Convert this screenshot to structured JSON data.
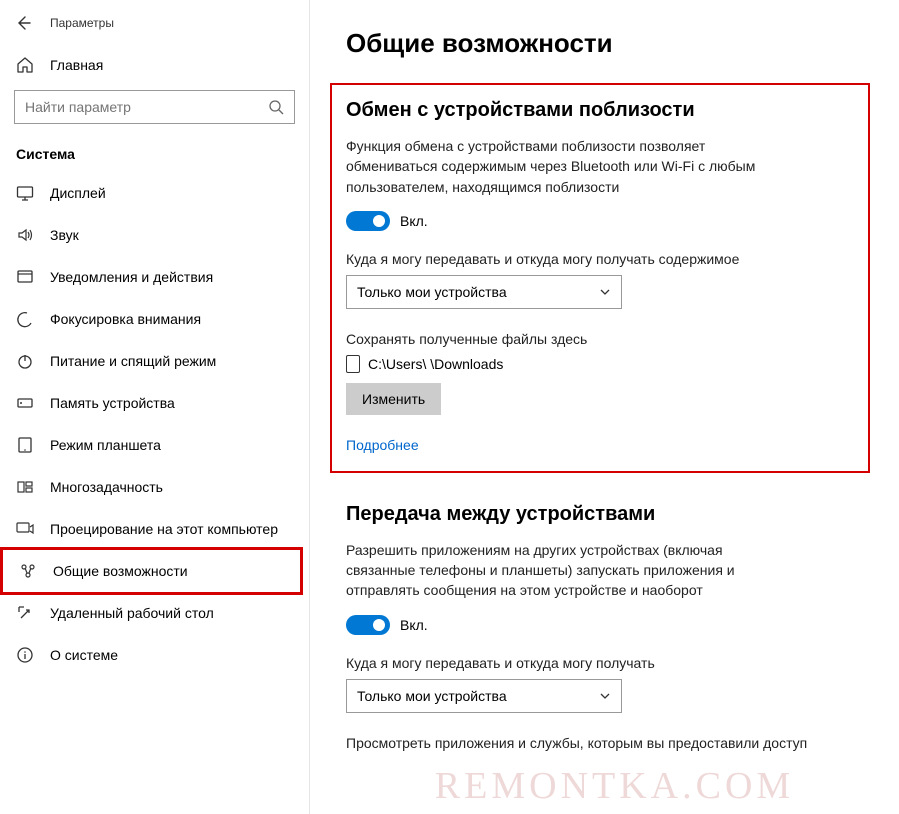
{
  "app_title": "Параметры",
  "home_label": "Главная",
  "search_placeholder": "Найти параметр",
  "category": "Система",
  "nav": [
    {
      "label": "Дисплей"
    },
    {
      "label": "Звук"
    },
    {
      "label": "Уведомления и действия"
    },
    {
      "label": "Фокусировка внимания"
    },
    {
      "label": "Питание и спящий режим"
    },
    {
      "label": "Память устройства"
    },
    {
      "label": "Режим планшета"
    },
    {
      "label": "Многозадачность"
    },
    {
      "label": "Проецирование на этот компьютер"
    },
    {
      "label": "Общие возможности"
    },
    {
      "label": "Удаленный рабочий стол"
    },
    {
      "label": "О системе"
    }
  ],
  "page_title": "Общие возможности",
  "section1": {
    "title": "Обмен с устройствами поблизости",
    "desc": "Функция обмена с устройствами поблизости позволяет обмениваться содержимым через Bluetooth или Wi-Fi с любым пользователем, находящимся поблизости",
    "toggle_label": "Вкл.",
    "share_label": "Куда я могу передавать и откуда могу получать содержимое",
    "dropdown_value": "Только мои устройства",
    "save_label": "Сохранять полученные файлы здесь",
    "save_path": "C:\\Users\\        \\Downloads",
    "change_btn": "Изменить",
    "more_link": "Подробнее"
  },
  "section2": {
    "title": "Передача между устройствами",
    "desc": "Разрешить приложениям на других устройствах (включая связанные телефоны и планшеты) запускать приложения и отправлять сообщения на этом устройстве и наоборот",
    "toggle_label": "Вкл.",
    "share_label": "Куда я могу передавать и откуда могу получать",
    "dropdown_value": "Только мои устройства",
    "apps_label": "Просмотреть приложения и службы, которым вы предоставили доступ"
  },
  "watermark": "REMONTKA.COM"
}
